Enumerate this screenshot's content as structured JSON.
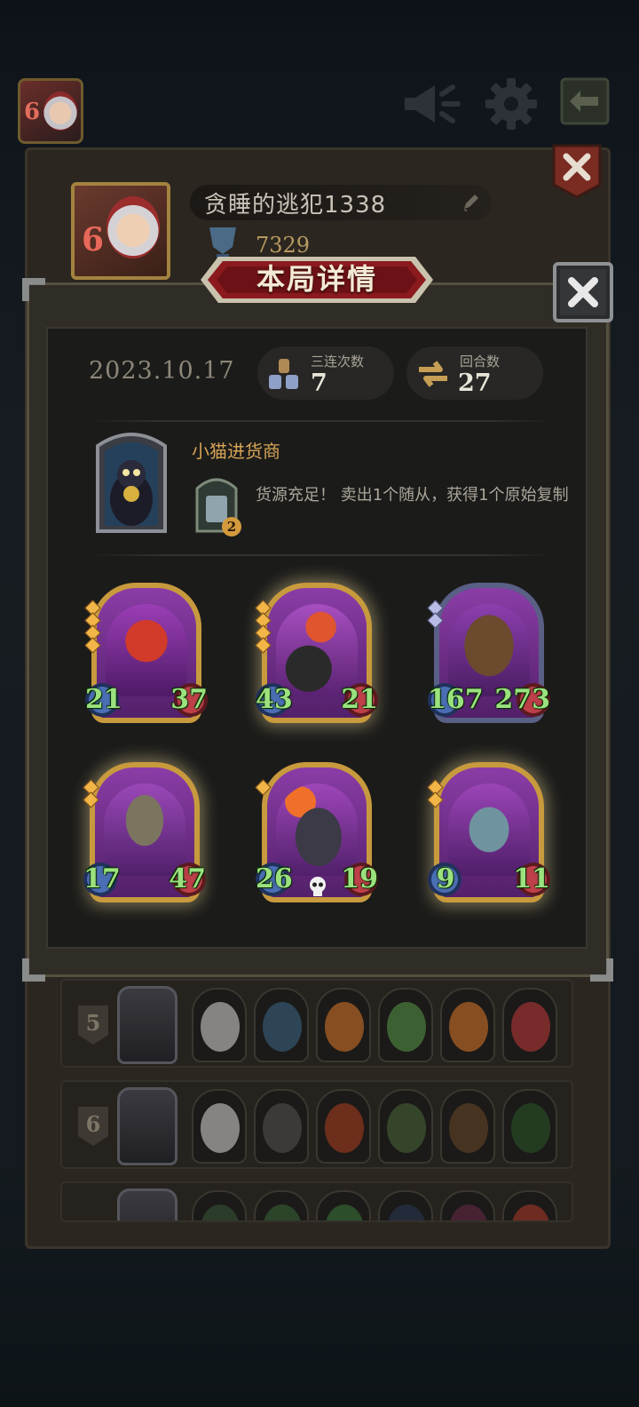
{
  "profile": {
    "level": "6",
    "nickname": "贪睡的逃犯1338",
    "trophy_score": "7329"
  },
  "modal": {
    "title": "本局详情",
    "date": "2023.10.17",
    "stats": [
      {
        "label": "三连次数",
        "value": "7"
      },
      {
        "label": "回合数",
        "value": "27"
      }
    ],
    "hero": {
      "name": "小猫进货商",
      "power_level": "2",
      "power_description": "货源充足！ 卖出1个随从，获得1个原始复制"
    },
    "minions": [
      {
        "attack": "21",
        "health": "37",
        "tier_gems": 4,
        "frame": "gold",
        "art": "red-dragon-demon",
        "glow": false,
        "skull": false
      },
      {
        "attack": "43",
        "health": "21",
        "tier_gems": 4,
        "frame": "gold",
        "art": "scorpion",
        "glow": true,
        "skull": false
      },
      {
        "attack": "167",
        "health": "273",
        "tier_gems": 2,
        "frame": "blue",
        "art": "tree-mask",
        "glow": false,
        "skull": false
      },
      {
        "attack": "17",
        "health": "47",
        "tier_gems": 2,
        "frame": "gold",
        "art": "scarecrow",
        "glow": true,
        "skull": false
      },
      {
        "attack": "26",
        "health": "19",
        "tier_gems": 1,
        "frame": "gold",
        "art": "flaming-boar",
        "glow": false,
        "skull": true
      },
      {
        "attack": "9",
        "health": "11",
        "tier_gems": 2,
        "frame": "gold",
        "art": "feathered-demon",
        "glow": true,
        "skull": false
      }
    ]
  },
  "history": [
    {
      "rank": "5"
    },
    {
      "rank": "6"
    },
    {
      "rank": ""
    }
  ],
  "icons": {
    "megaphone": "megaphone-icon",
    "settings": "gear-icon",
    "exit": "exit-icon",
    "close": "close-icon",
    "edit": "pencil-icon",
    "trophy": "trophy-icon",
    "triple": "triple-icon",
    "rounds": "refresh-icon"
  },
  "colors": {
    "accent_gold": "#d7a455",
    "title_banner": "#8b1a1e",
    "stat_green": "#9be27f"
  }
}
